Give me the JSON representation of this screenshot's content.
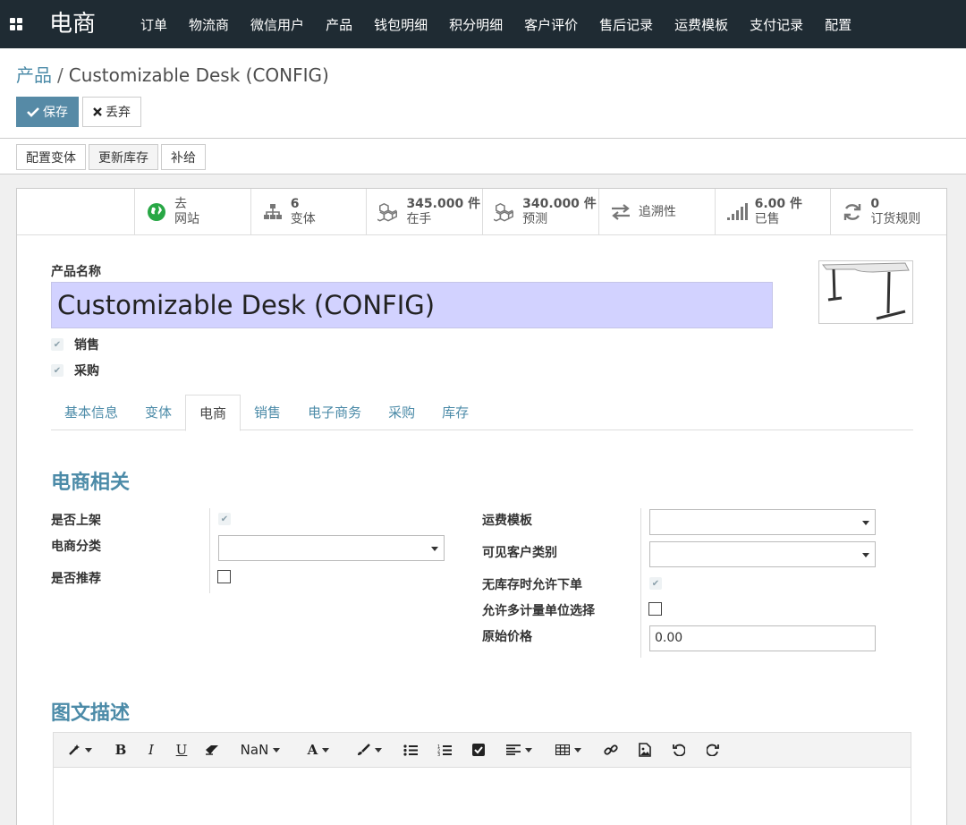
{
  "topnav": {
    "brand": "电商",
    "menu": [
      "订单",
      "物流商",
      "微信用户",
      "产品",
      "钱包明细",
      "积分明细",
      "客户评价",
      "售后记录",
      "运费模板",
      "支付记录",
      "配置"
    ]
  },
  "breadcrumb": {
    "parent": "产品",
    "separator": "/",
    "current": "Customizable Desk (CONFIG)"
  },
  "buttons": {
    "save": "保存",
    "discard": "丢弃"
  },
  "actions": [
    "配置变体",
    "更新库存",
    "补给"
  ],
  "smart_buttons": [
    {
      "icon": "globe-icon",
      "top": "去",
      "bottom": "网站"
    },
    {
      "icon": "sitemap-icon",
      "top": "6",
      "bottom": "变体"
    },
    {
      "icon": "cubes-icon",
      "top": "345.000 件",
      "bottom": "在手"
    },
    {
      "icon": "cubes-icon",
      "top": "340.000 件",
      "bottom": "预测"
    },
    {
      "icon": "exchange-icon",
      "top": "",
      "bottom": "追溯性"
    },
    {
      "icon": "signal-icon",
      "top": "6.00 件",
      "bottom": "已售"
    },
    {
      "icon": "refresh-icon",
      "top": "0",
      "bottom": "订货规则"
    }
  ],
  "product": {
    "name_label": "产品名称",
    "name": "Customizable Desk (CONFIG)",
    "sale_label": "销售",
    "purchase_label": "采购"
  },
  "tabs": [
    "基本信息",
    "变体",
    "电商",
    "销售",
    "电子商务",
    "采购",
    "库存"
  ],
  "active_tab": "电商",
  "ecommerce": {
    "title": "电商相关",
    "published_label": "是否上架",
    "category_label": "电商分类",
    "recommended_label": "是否推荐",
    "shipping_template_label": "运费模板",
    "visible_customer_label": "可见客户类别",
    "allow_no_stock_label": "无库存时允许下单",
    "multi_uom_label": "允许多计量单位选择",
    "original_price_label": "原始价格",
    "original_price_value": "0.00"
  },
  "description": {
    "title": "图文描述",
    "font_size_label": "NaN"
  },
  "colors": {
    "nav_bg": "#1f2b33",
    "accent": "#4c8ba8",
    "primary_button": "#568aa6",
    "name_highlight": "#d2d2ff"
  }
}
